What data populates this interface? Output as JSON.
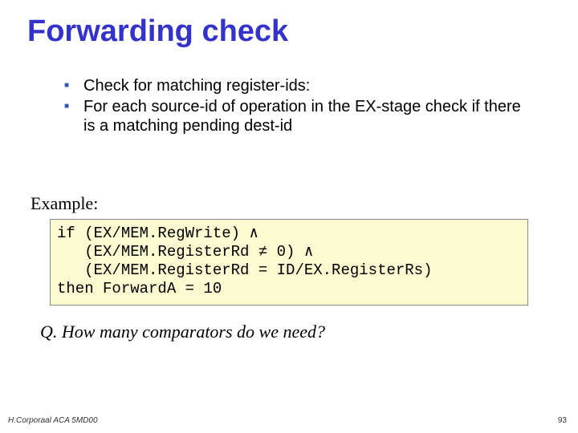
{
  "title": "Forwarding check",
  "bullets": [
    "Check for matching register-ids:",
    "For each source-id of operation in the EX-stage check if there is a matching pending dest-id"
  ],
  "example_label": "Example:",
  "code": {
    "l1a": "if (EX/MEM.RegWrite) ",
    "l1b": "∧",
    "l2a": "   (EX/MEM.RegisterRd ",
    "l2b": "≠",
    "l2c": " 0) ",
    "l2d": "∧",
    "l3": "   (EX/MEM.RegisterRd = ID/EX.RegisterRs)",
    "l4": "then ForwardA = 10"
  },
  "question": "Q. How many comparators do we need?",
  "footer": {
    "left": "H.Corporaal  ACA 5MD00",
    "right": "93"
  }
}
